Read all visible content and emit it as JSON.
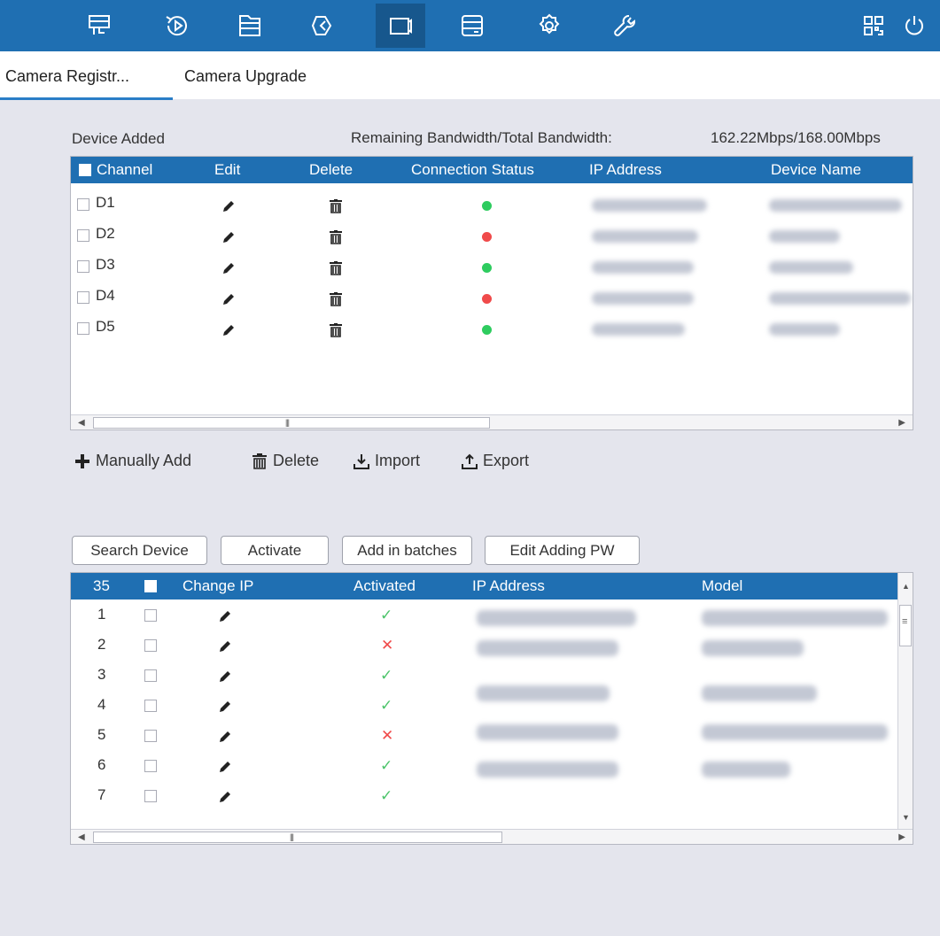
{
  "colors": {
    "primary": "#1f6fb2",
    "online": "#2ecc5f",
    "offline": "#f04a4a",
    "check": "#4cc46a",
    "cross": "#f04a4a"
  },
  "toolbar": {
    "icons": [
      "live-view-icon",
      "playback-icon",
      "file-icon",
      "back-icon",
      "camera-icon",
      "storage-icon",
      "settings-icon",
      "maintenance-icon",
      "qr-code-icon",
      "power-icon"
    ]
  },
  "tabs": {
    "registration": "Camera Registr...",
    "upgrade": "Camera Upgrade"
  },
  "device_added": {
    "title": "Device Added",
    "bandwidth_label": "Remaining Bandwidth/Total Bandwidth:",
    "bandwidth_value": "162.22Mbps/168.00Mbps",
    "columns": {
      "channel": "Channel",
      "edit": "Edit",
      "delete": "Delete",
      "status": "Connection Status",
      "ip": "IP Address",
      "name": "Device Name"
    },
    "rows": [
      {
        "channel": "D1",
        "status": "online"
      },
      {
        "channel": "D2",
        "status": "offline"
      },
      {
        "channel": "D3",
        "status": "online"
      },
      {
        "channel": "D4",
        "status": "offline"
      },
      {
        "channel": "D5",
        "status": "online"
      }
    ]
  },
  "actions": {
    "manual_add": "Manually Add",
    "delete": "Delete",
    "import": "Import",
    "export": "Export"
  },
  "search": {
    "buttons": {
      "search": "Search Device",
      "activate": "Activate",
      "batch": "Add in batches",
      "edit_pw": "Edit Adding PW"
    },
    "columns": {
      "count": "35",
      "change_ip": "Change IP",
      "activated": "Activated",
      "ip": "IP Address",
      "model": "Model"
    },
    "rows": [
      {
        "index": "1",
        "activated": "✓"
      },
      {
        "index": "2",
        "activated": "✕"
      },
      {
        "index": "3",
        "activated": "✓"
      },
      {
        "index": "4",
        "activated": "✓"
      },
      {
        "index": "5",
        "activated": "✕"
      },
      {
        "index": "6",
        "activated": "✓"
      },
      {
        "index": "7",
        "activated": "✓"
      }
    ]
  }
}
